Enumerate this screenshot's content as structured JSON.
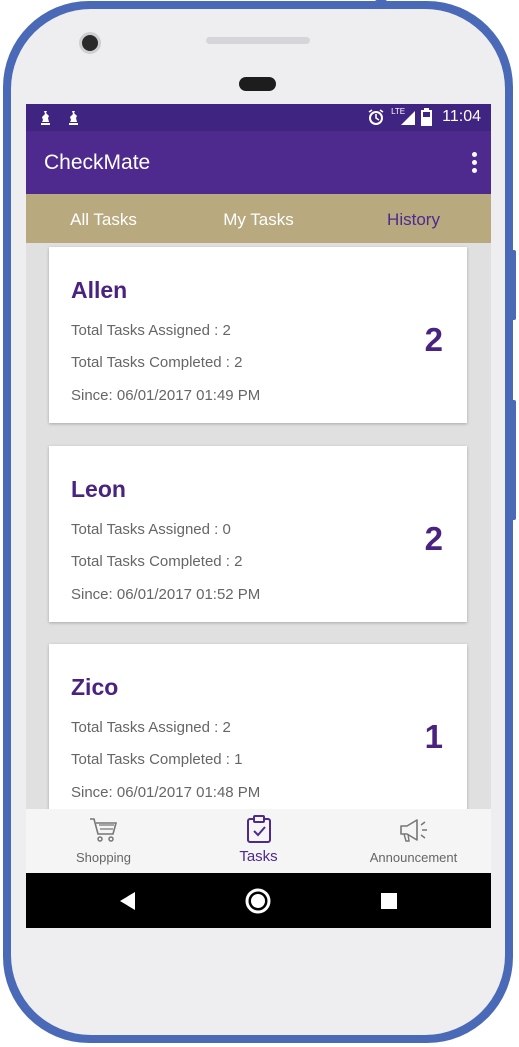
{
  "status_bar": {
    "time": "11:04",
    "network": "LTE",
    "icons": [
      "chess-icon",
      "chess-icon",
      "alarm-icon",
      "signal-icon",
      "battery-icon"
    ]
  },
  "app_bar": {
    "title": "CheckMate",
    "overflow_icon": "more-vert-icon"
  },
  "tabs": [
    {
      "label": "All Tasks",
      "active": false
    },
    {
      "label": "My Tasks",
      "active": false
    },
    {
      "label": "History",
      "active": true
    }
  ],
  "cards": [
    {
      "name": "Allen",
      "assigned": "Total Tasks Assigned : 2",
      "completed": "Total Tasks Completed : 2",
      "since": "Since: 06/01/2017 01:49 PM",
      "count": "2"
    },
    {
      "name": "Leon",
      "assigned": "Total Tasks Assigned : 0",
      "completed": "Total Tasks Completed : 2",
      "since": "Since: 06/01/2017 01:52 PM",
      "count": "2"
    },
    {
      "name": "Zico",
      "assigned": "Total Tasks Assigned : 2",
      "completed": "Total Tasks Completed : 1",
      "since": "Since: 06/01/2017 01:48 PM",
      "count": "1"
    }
  ],
  "bottom_nav": [
    {
      "label": "Shopping",
      "icon": "cart-icon",
      "active": false
    },
    {
      "label": "Tasks",
      "icon": "clipboard-check-icon",
      "active": true
    },
    {
      "label": "Announcement",
      "icon": "megaphone-icon",
      "active": false
    }
  ],
  "colors": {
    "primary": "#4e2a8e",
    "status_bar": "#3f2481",
    "tab_bar": "#b8a97f",
    "accent_text": "#4a2380",
    "frame": "#4a6ab8"
  }
}
